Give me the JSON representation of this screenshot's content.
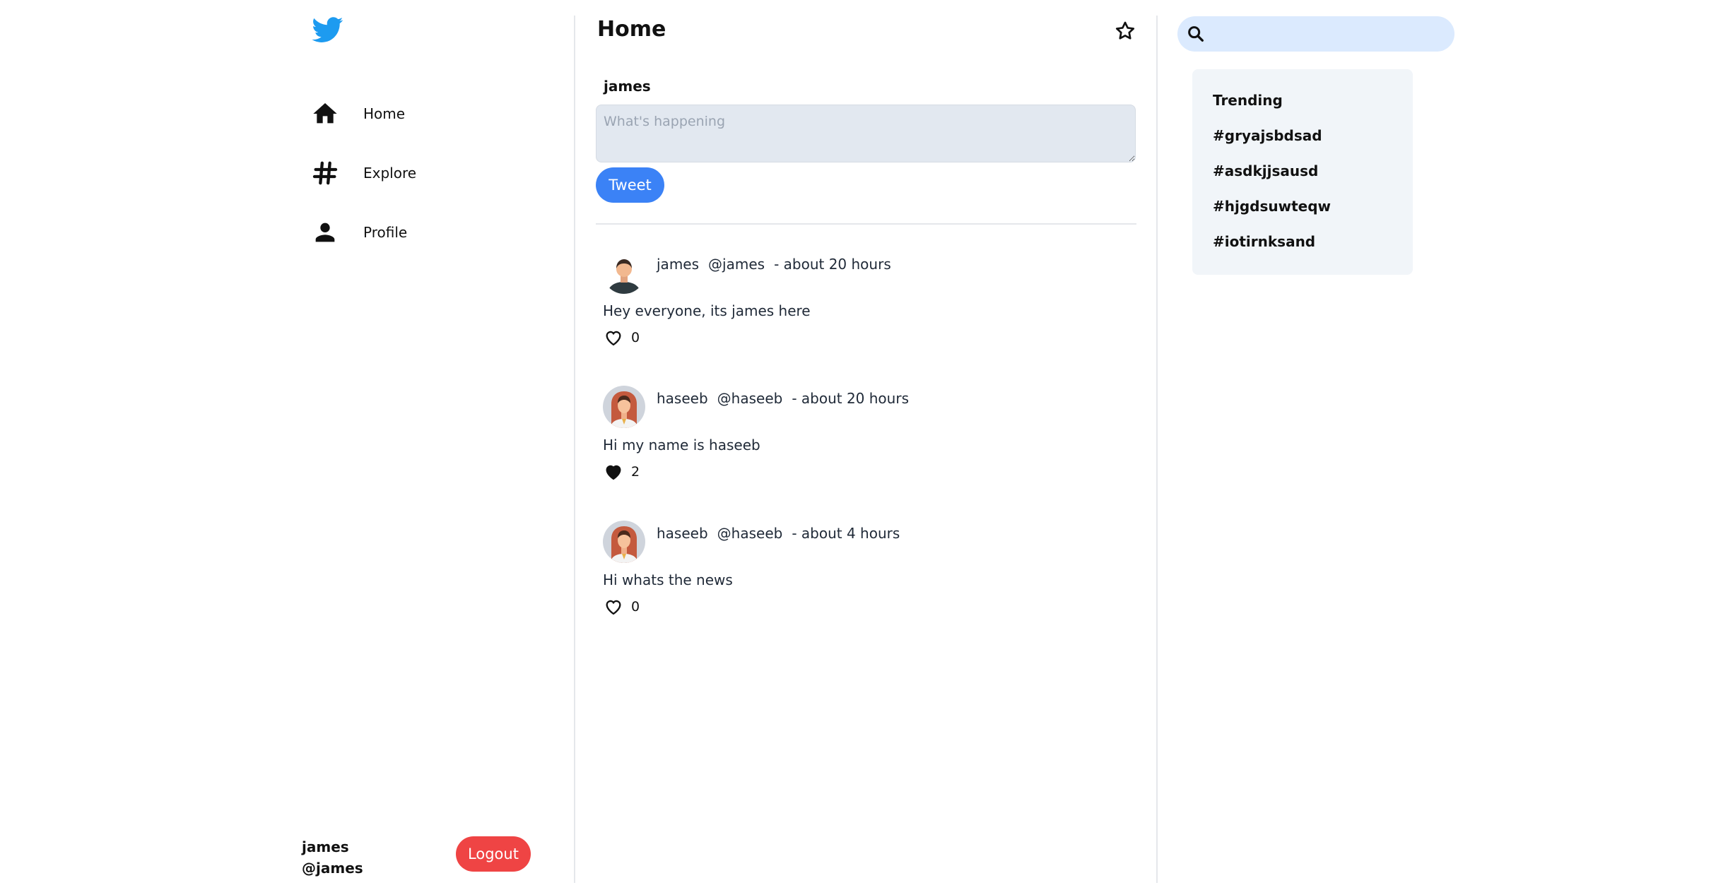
{
  "colors": {
    "brand": "#1d9bf0",
    "accent": "#3b82f6",
    "logout": "#ef4444",
    "search_bg": "#dbeafe",
    "panel_bg": "#f1f5f9"
  },
  "sidebar": {
    "logo_icon": "twitter-bird-icon",
    "nav": [
      {
        "label": "Home",
        "icon": "home-icon"
      },
      {
        "label": "Explore",
        "icon": "hashtag-icon"
      },
      {
        "label": "Profile",
        "icon": "person-icon"
      }
    ],
    "user": {
      "name": "james",
      "handle": "@james"
    },
    "logout_label": "Logout"
  },
  "header": {
    "title": "Home",
    "star_icon": "star-icon"
  },
  "composer": {
    "user": "james",
    "placeholder": "What's happening",
    "value": "",
    "button_label": "Tweet"
  },
  "tweets": [
    {
      "name": "james",
      "handle": "@james",
      "time": "- about 20 hours",
      "text": "Hey everyone, its james here",
      "likes": "0",
      "liked": false
    },
    {
      "name": "haseeb",
      "handle": "@haseeb",
      "time": "- about 20 hours",
      "text": "Hi my name is haseeb",
      "likes": "2",
      "liked": true
    },
    {
      "name": "haseeb",
      "handle": "@haseeb",
      "time": "- about 4 hours",
      "text": "Hi whats the news",
      "likes": "0",
      "liked": false
    }
  ],
  "search": {
    "placeholder": "",
    "icon": "search-icon"
  },
  "trending": {
    "title": "Trending",
    "items": [
      "#gryajsbdsad",
      "#asdkjjsausd",
      "#hjgdsuwteqw",
      "#iotirnksand"
    ]
  }
}
